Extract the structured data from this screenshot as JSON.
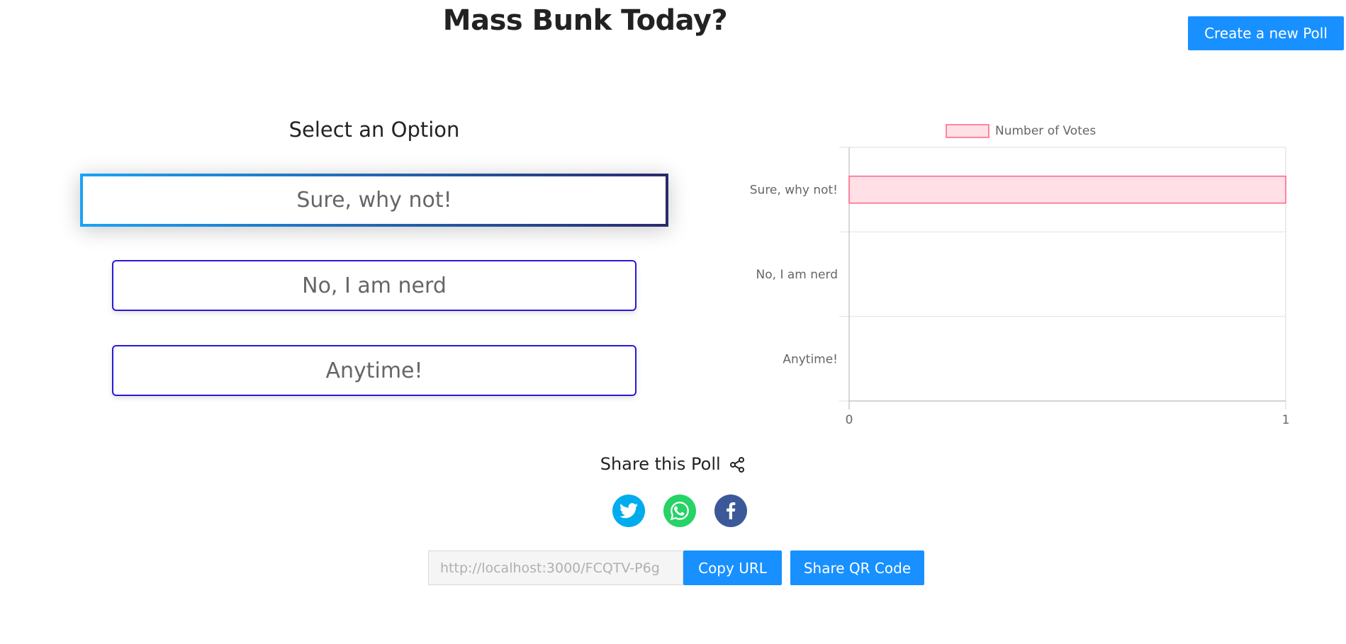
{
  "poll": {
    "title": "Mass Bunk Today?",
    "create_button": "Create a new Poll",
    "select_heading": "Select an Option",
    "options": [
      {
        "label": "Sure, why not!",
        "selected": true
      },
      {
        "label": "No, I am nerd",
        "selected": false
      },
      {
        "label": "Anytime!",
        "selected": false
      }
    ]
  },
  "chart_data": {
    "type": "bar",
    "orientation": "horizontal",
    "categories": [
      "Sure, why not!",
      "No, I am nerd",
      "Anytime!"
    ],
    "series": [
      {
        "name": "Number of Votes",
        "values": [
          1,
          0,
          0
        ],
        "fill": "#ffe0e6",
        "stroke": "#ff6384"
      }
    ],
    "xlim": [
      0,
      1
    ],
    "x_ticks": [
      "0",
      "1"
    ],
    "legend": "top",
    "grid": true
  },
  "share": {
    "heading": "Share this Poll",
    "share_icon": "share-nodes-icon",
    "social": [
      {
        "name": "twitter-icon",
        "color": "#00aced"
      },
      {
        "name": "whatsapp-icon",
        "color": "#25d366"
      },
      {
        "name": "facebook-icon",
        "color": "#3b5998"
      }
    ],
    "url_value": "http://localhost:3000/FCQTV-P6g",
    "copy_button": "Copy URL",
    "qr_button": "Share QR Code"
  }
}
